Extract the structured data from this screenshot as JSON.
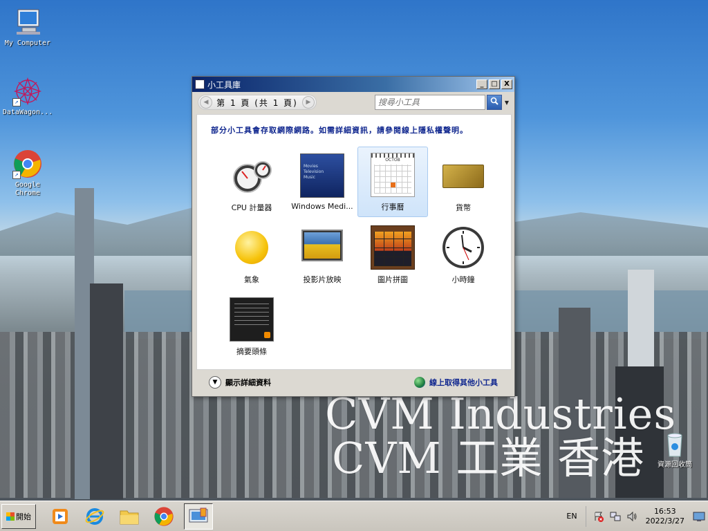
{
  "desktop": {
    "icons": [
      {
        "label": "My Computer"
      },
      {
        "label": "DataWagon..."
      },
      {
        "label": "Google\nChrome"
      }
    ],
    "watermark_line1": "CVM Industries",
    "watermark_line2": "CVM 工業 香港",
    "recycle_bin_label": "資源回收筒"
  },
  "window": {
    "title": "小工具庫",
    "title_buttons": [
      "_",
      "□",
      "X"
    ],
    "pager_text": "第 1 頁 (共 1 頁)",
    "search_placeholder": "搜尋小工具",
    "notice": "部分小工具會存取網際網路。如需詳細資訊，請參閱線上隱私權聲明。",
    "gadgets": [
      {
        "label": "CPU 計量器",
        "icon": "cpu-meter-icon"
      },
      {
        "label": "Windows Medi...",
        "icon": "windows-media-center-icon"
      },
      {
        "label": "行事曆",
        "icon": "calendar-icon",
        "selected": true
      },
      {
        "label": "貨幣",
        "icon": "currency-icon"
      },
      {
        "label": "氣象",
        "icon": "weather-icon"
      },
      {
        "label": "投影片放映",
        "icon": "slideshow-icon"
      },
      {
        "label": "圖片拼圖",
        "icon": "picture-puzzle-icon"
      },
      {
        "label": "小時鐘",
        "icon": "clock-icon"
      },
      {
        "label": "摘要頭條",
        "icon": "feed-headlines-icon"
      }
    ],
    "calendar_month": "OCTOB",
    "media_center_lines": [
      "Movies",
      "Television",
      "Music"
    ],
    "show_details": "顯示詳細資料",
    "get_more_online": "線上取得其他小工具"
  },
  "taskbar": {
    "start_label": "開始",
    "language": "EN",
    "time": "16:53",
    "date": "2022/3/27"
  },
  "colors": {
    "notice_text": "#10278f",
    "selected_bg": "#cfe4fa"
  }
}
